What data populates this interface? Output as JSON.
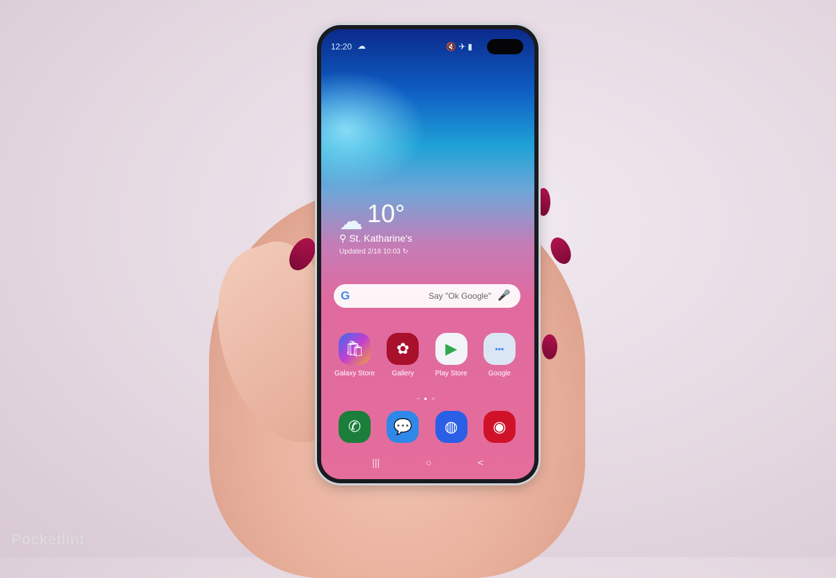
{
  "status_bar": {
    "time": "12:20",
    "weather_icon": "cloud-icon",
    "icons": [
      "mute-icon",
      "airplane-icon",
      "battery-icon"
    ]
  },
  "weather_widget": {
    "temperature": "10°",
    "location": "St. Katharine's",
    "updated": "Updated 2/18 10:03"
  },
  "search_bar": {
    "logo": "G",
    "hint": "Say \"Ok Google\""
  },
  "home_apps": [
    {
      "label": "Galaxy Store",
      "icon": "shopping-bag-icon"
    },
    {
      "label": "Gallery",
      "icon": "flower-icon"
    },
    {
      "label": "Play Store",
      "icon": "play-triangle-icon"
    },
    {
      "label": "Google",
      "icon": "folder-icon"
    }
  ],
  "dock_apps": [
    {
      "label": "Phone",
      "icon": "phone-icon"
    },
    {
      "label": "Messages",
      "icon": "chat-icon"
    },
    {
      "label": "Internet",
      "icon": "planet-icon"
    },
    {
      "label": "Camera",
      "icon": "camera-icon"
    }
  ],
  "page_indicator": {
    "pages": 3,
    "current": 2
  },
  "nav_bar": {
    "recents": "|||",
    "home": "○",
    "back": "<"
  },
  "watermark": "Pocketlint",
  "colors": {
    "galaxy_store": "#8a4de0",
    "gallery": "#a8102c",
    "play_store": "#f2f4f7",
    "google_folder": "#dbe6f4",
    "phone": "#1b7f3b",
    "messages": "#2f88e8",
    "internet": "#2a5fe6",
    "camera": "#d01228"
  }
}
